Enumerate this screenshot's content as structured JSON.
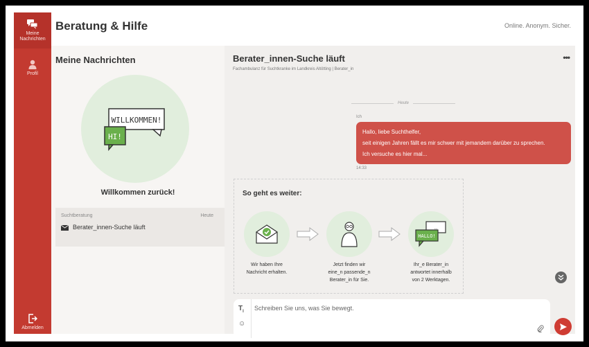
{
  "colors": {
    "brand": "#c33a30",
    "bubble": "#cf5149",
    "accent_green": "#e1eedd"
  },
  "sidebar": {
    "items": [
      {
        "label": "Meine Nachrichten",
        "icon": "chat-bubbles-icon",
        "active": true
      },
      {
        "label": "Profil",
        "icon": "user-icon",
        "active": false
      }
    ],
    "logout_label": "Abmelden"
  },
  "header": {
    "title": "Beratung & Hilfe",
    "tagline": "Online. Anonym. Sicher."
  },
  "sessions": {
    "title": "Meine Nachrichten",
    "welcome_bubble_1": "WILLKOMMEN!",
    "welcome_bubble_2": "HI!",
    "welcome_text": "Willkommen zurück!",
    "items": [
      {
        "type": "Suchtberatung",
        "date": "Heute",
        "status": "Berater_innen-Suche läuft"
      }
    ]
  },
  "chat": {
    "title": "Berater_innen-Suche läuft",
    "subtitle": "Fachambulanz für Suchtkranke im Landkreis Altötting  |  Berater_in",
    "date_separator": "Heute",
    "message": {
      "sender": "Ich",
      "lines": [
        "Hallo, liebe Suchthelfer,",
        "seit einigen Jahren fällt es mir schwer mit jemandem darüber zu sprechen.",
        "Ich versuche es hier mal..."
      ],
      "time": "14:33"
    },
    "next_steps": {
      "title": "So geht es weiter:",
      "steps": [
        {
          "icon": "envelope-check-icon",
          "text_1": "Wir haben Ihre",
          "text_2": "Nachricht erhalten.",
          "text_3": ""
        },
        {
          "icon": "counselor-icon",
          "text_1": "Jetzt finden wir",
          "text_2": "eine_n passende_n",
          "text_3": "Berater_in für Sie."
        },
        {
          "icon": "hallo-bubble-icon",
          "text_1": "Ihr_e Berater_in",
          "text_2": "antwortet innerhalb",
          "text_3": "von 2 Werktagen.",
          "bubble_text": "HALLO!"
        }
      ]
    },
    "composer": {
      "placeholder": "Schreiben Sie uns, was Sie bewegt."
    }
  }
}
